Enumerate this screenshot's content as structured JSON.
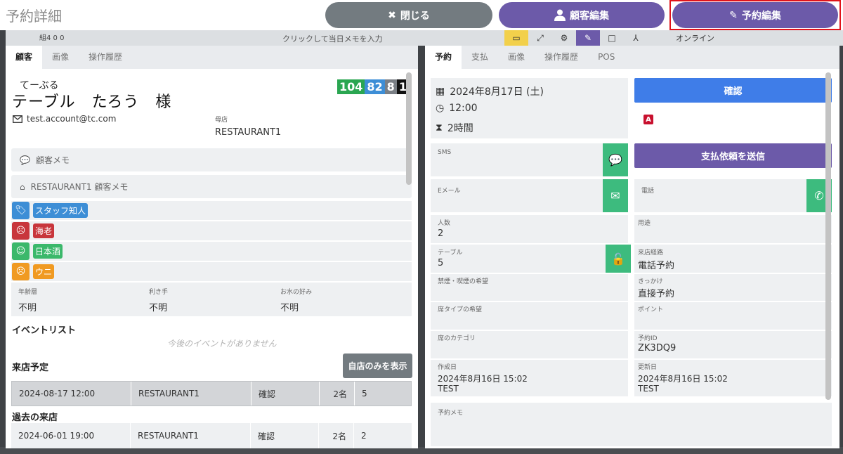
{
  "header": {
    "title": "予約詳細",
    "close_label": "閉じる",
    "customer_edit_label": "顧客編集",
    "reservation_edit_label": "予約編集"
  },
  "background": {
    "memo_placeholder": "クリックして当日メモを入力",
    "left_info": "組4 0 0",
    "online_label": "オンライン"
  },
  "customer_panel": {
    "tabs": [
      "顧客",
      "画像",
      "操作履歴"
    ],
    "kana": "てーぶる",
    "name": "テーブル　たろう　様",
    "badges": [
      "104",
      "82",
      "8",
      "1"
    ],
    "email": "test.account@tc.com",
    "home_shop_label": "母店",
    "home_shop_value": "RESTAURANT1",
    "customer_memo_label": "顧客メモ",
    "shop_memo_label": "RESTAURANT1 顧客メモ",
    "tags": [
      {
        "label": "スタッフ知人",
        "color": "#3d8ed6",
        "icon": "tag-icon"
      },
      {
        "label": "海老",
        "color": "#c8363c",
        "icon": "dizzy-face-icon"
      },
      {
        "label": "日本酒",
        "color": "#3bb86b",
        "icon": "smile-face-icon"
      },
      {
        "label": "ウニ",
        "color": "#f09a22",
        "icon": "frown-face-icon"
      }
    ],
    "attributes": [
      {
        "label": "年齢層",
        "value": "不明"
      },
      {
        "label": "利き手",
        "value": "不明"
      },
      {
        "label": "お水の好み",
        "value": "不明"
      }
    ],
    "event_list_title": "イベントリスト",
    "no_events": "今後のイベントがありません",
    "upcoming_title": "来店予定",
    "only_my_shop_label": "自店のみを表示",
    "upcoming_visits": [
      {
        "datetime": "2024-08-17 12:00",
        "shop": "RESTAURANT1",
        "status": "確認",
        "people": "2名",
        "table": "5"
      }
    ],
    "past_title": "過去の来店",
    "past_visits": [
      {
        "datetime": "2024-06-01 19:00",
        "shop": "RESTAURANT1",
        "status": "確認",
        "people": "2名",
        "table": "2"
      }
    ]
  },
  "reservation_panel": {
    "tabs": [
      "予約",
      "支払",
      "画像",
      "操作履歴",
      "POS"
    ],
    "date": "2024年8月17日 (土)",
    "time": "12:00",
    "duration": "2時間",
    "confirm_label": "確認",
    "source_badge": "A",
    "sms_label": "SMS",
    "email_label": "Eメール",
    "phone_label": "電話",
    "send_payment_label": "支払依頼を送信",
    "fields": {
      "people_label": "人数",
      "people_value": "2",
      "purpose_label": "用途",
      "purpose_value": "",
      "table_label": "テーブル",
      "table_value": "5",
      "route_label": "来店経路",
      "route_value": "電話予約",
      "smoking_label": "禁煙・喫煙の希望",
      "smoking_value": "",
      "trigger_label": "きっかけ",
      "trigger_value": "直接予約",
      "seat_type_label": "席タイプの希望",
      "seat_type_value": "",
      "points_label": "ポイント",
      "points_value": "",
      "seat_category_label": "席のカテゴリ",
      "seat_category_value": "",
      "reservation_id_label": "予約ID",
      "reservation_id_value": "ZK3DQ9",
      "created_label": "作成日",
      "created_value": "2024年8月16日 15:02",
      "created_by": "TEST",
      "updated_label": "更新日",
      "updated_value": "2024年8月16日 15:02",
      "updated_by": "TEST",
      "memo_label": "予約メモ"
    }
  }
}
